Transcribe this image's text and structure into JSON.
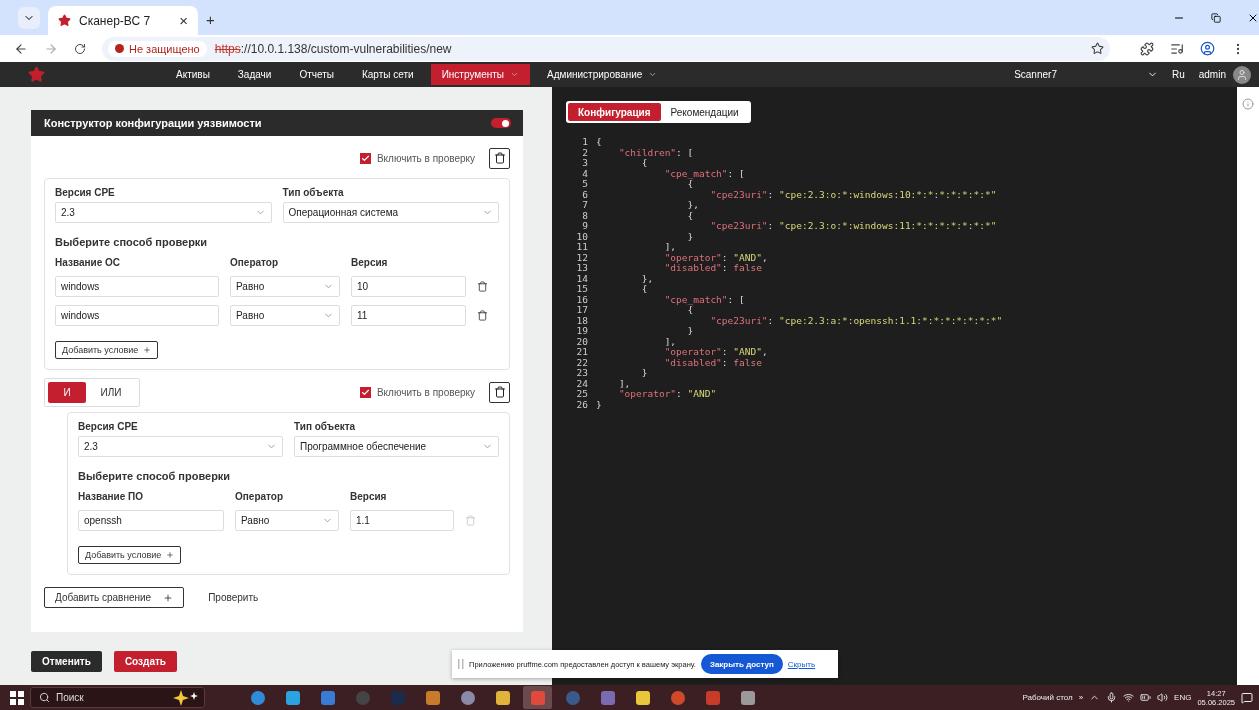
{
  "browser": {
    "tab": {
      "title": "Сканер-ВС 7",
      "close": "×"
    },
    "new_tab": "+",
    "security": "Не защищено",
    "url_scheme": "https",
    "url_rest": "://10.0.1.138/custom-vulnerabilities/new"
  },
  "nav": {
    "items": [
      {
        "label": "Активы",
        "selected": false,
        "dropdown": false
      },
      {
        "label": "Задачи",
        "selected": false,
        "dropdown": false
      },
      {
        "label": "Отчеты",
        "selected": false,
        "dropdown": false
      },
      {
        "label": "Карты сети",
        "selected": false,
        "dropdown": false
      },
      {
        "label": "Инструменты",
        "selected": true,
        "dropdown": true
      },
      {
        "label": "Администрирование",
        "selected": false,
        "dropdown": true
      }
    ],
    "scanner": "Scanner7",
    "language": "Ru",
    "user": "admin"
  },
  "builder": {
    "title": "Конструктор конфигурации уязвимости",
    "enabled": true,
    "groups": [
      {
        "include": {
          "label": "Включить в проверку",
          "checked": true
        },
        "cpe": {
          "label": "Версия CPE",
          "value": "2.3"
        },
        "object_type": {
          "label": "Тип объекта",
          "value": "Операционная система"
        },
        "heading": "Выберите способ проверки",
        "columns": [
          "Название ОС",
          "Оператор",
          "Версия"
        ],
        "conditions": [
          {
            "name": "windows",
            "operator": "Равно",
            "version": "10",
            "delete_disabled": false
          },
          {
            "name": "windows",
            "operator": "Равно",
            "version": "11",
            "delete_disabled": false
          }
        ],
        "add_label": "Добавить условие"
      },
      {
        "logic": [
          {
            "label": "И",
            "selected": true
          },
          {
            "label": "ИЛИ",
            "selected": false
          }
        ],
        "include": {
          "label": "Включить в проверку",
          "checked": true
        },
        "cpe": {
          "label": "Версия CPE",
          "value": "2.3"
        },
        "object_type": {
          "label": "Тип объекта",
          "value": "Программное обеспечение"
        },
        "heading": "Выберите способ проверки",
        "columns": [
          "Название ПО",
          "Оператор",
          "Версия"
        ],
        "conditions": [
          {
            "name": "openssh",
            "operator": "Равно",
            "version": "1.1",
            "delete_disabled": true
          }
        ],
        "add_label": "Добавить условие"
      }
    ],
    "add_comparison": "Добавить сравнение",
    "check": "Проверить"
  },
  "actions": {
    "cancel": "Отменить",
    "create": "Создать"
  },
  "preview": {
    "tabs": [
      {
        "label": "Конфигурация",
        "selected": true
      },
      {
        "label": "Рекомендации",
        "selected": false
      }
    ],
    "lines": [
      {
        "number": "1",
        "tokens": [
          {
            "kind": "punct",
            "text": "{"
          }
        ]
      },
      {
        "number": "2",
        "tokens": [
          {
            "kind": "key",
            "text": "    \"children\""
          },
          {
            "kind": "punct",
            "text": ": ["
          }
        ]
      },
      {
        "number": "3",
        "tokens": [
          {
            "kind": "punct",
            "text": "        {"
          }
        ]
      },
      {
        "number": "4",
        "tokens": [
          {
            "kind": "key",
            "text": "            \"cpe_match\""
          },
          {
            "kind": "punct",
            "text": ": ["
          }
        ]
      },
      {
        "number": "5",
        "tokens": [
          {
            "kind": "punct",
            "text": "                {"
          }
        ]
      },
      {
        "number": "6",
        "tokens": [
          {
            "kind": "key",
            "text": "                    \"cpe23uri\""
          },
          {
            "kind": "punct",
            "text": ": "
          },
          {
            "kind": "string",
            "text": "\"cpe:2.3:o:*:windows:10:*:*:*:*:*:*:*\""
          }
        ]
      },
      {
        "number": "7",
        "tokens": [
          {
            "kind": "punct",
            "text": "                },"
          }
        ]
      },
      {
        "number": "8",
        "tokens": [
          {
            "kind": "punct",
            "text": "                {"
          }
        ]
      },
      {
        "number": "9",
        "tokens": [
          {
            "kind": "key",
            "text": "                    \"cpe23uri\""
          },
          {
            "kind": "punct",
            "text": ": "
          },
          {
            "kind": "string",
            "text": "\"cpe:2.3:o:*:windows:11:*:*:*:*:*:*:*\""
          }
        ]
      },
      {
        "number": "10",
        "tokens": [
          {
            "kind": "punct",
            "text": "                }"
          }
        ]
      },
      {
        "number": "11",
        "tokens": [
          {
            "kind": "punct",
            "text": "            ],"
          }
        ]
      },
      {
        "number": "12",
        "tokens": [
          {
            "kind": "key",
            "text": "            \"operator\""
          },
          {
            "kind": "punct",
            "text": ": "
          },
          {
            "kind": "string",
            "text": "\"AND\""
          },
          {
            "kind": "punct",
            "text": ","
          }
        ]
      },
      {
        "number": "13",
        "tokens": [
          {
            "kind": "key",
            "text": "            \"disabled\""
          },
          {
            "kind": "punct",
            "text": ": "
          },
          {
            "kind": "bool",
            "text": "false"
          }
        ]
      },
      {
        "number": "14",
        "tokens": [
          {
            "kind": "punct",
            "text": "        },"
          }
        ]
      },
      {
        "number": "15",
        "tokens": [
          {
            "kind": "punct",
            "text": "        {"
          }
        ]
      },
      {
        "number": "16",
        "tokens": [
          {
            "kind": "key",
            "text": "            \"cpe_match\""
          },
          {
            "kind": "punct",
            "text": ": ["
          }
        ]
      },
      {
        "number": "17",
        "tokens": [
          {
            "kind": "punct",
            "text": "                {"
          }
        ]
      },
      {
        "number": "18",
        "tokens": [
          {
            "kind": "key",
            "text": "                    \"cpe23uri\""
          },
          {
            "kind": "punct",
            "text": ": "
          },
          {
            "kind": "string",
            "text": "\"cpe:2.3:a:*:openssh:1.1:*:*:*:*:*:*:*\""
          }
        ]
      },
      {
        "number": "19",
        "tokens": [
          {
            "kind": "punct",
            "text": "                }"
          }
        ]
      },
      {
        "number": "20",
        "tokens": [
          {
            "kind": "punct",
            "text": "            ],"
          }
        ]
      },
      {
        "number": "21",
        "tokens": [
          {
            "kind": "key",
            "text": "            \"operator\""
          },
          {
            "kind": "punct",
            "text": ": "
          },
          {
            "kind": "string",
            "text": "\"AND\""
          },
          {
            "kind": "punct",
            "text": ","
          }
        ]
      },
      {
        "number": "22",
        "tokens": [
          {
            "kind": "key",
            "text": "            \"disabled\""
          },
          {
            "kind": "punct",
            "text": ": "
          },
          {
            "kind": "bool",
            "text": "false"
          }
        ]
      },
      {
        "number": "23",
        "tokens": [
          {
            "kind": "punct",
            "text": "        }"
          }
        ]
      },
      {
        "number": "24",
        "tokens": [
          {
            "kind": "punct",
            "text": "    ],"
          }
        ]
      },
      {
        "number": "25",
        "tokens": [
          {
            "kind": "key",
            "text": "    \"operator\""
          },
          {
            "kind": "punct",
            "text": ": "
          },
          {
            "kind": "string",
            "text": "\"AND\""
          }
        ]
      },
      {
        "number": "26",
        "tokens": [
          {
            "kind": "punct",
            "text": "}"
          }
        ]
      }
    ]
  },
  "share_notice": {
    "text": "Приложению pruffme.com предоставлен доступ к вашему экрану.",
    "stop": "Закрыть доступ",
    "hide": "Скрыть"
  },
  "taskbar": {
    "search": "Поиск",
    "apps": [
      {
        "selected": false
      },
      {
        "selected": false
      },
      {
        "selected": false
      },
      {
        "selected": false
      },
      {
        "selected": false
      },
      {
        "selected": false
      },
      {
        "selected": false
      },
      {
        "selected": false
      },
      {
        "selected": true
      },
      {
        "selected": false
      },
      {
        "selected": false
      },
      {
        "selected": false
      },
      {
        "selected": false
      },
      {
        "selected": false
      },
      {
        "selected": false
      }
    ],
    "desktop": "Рабочий стол",
    "more": "»",
    "language": "ENG",
    "time": "14:27",
    "date": "05.06.2025"
  }
}
